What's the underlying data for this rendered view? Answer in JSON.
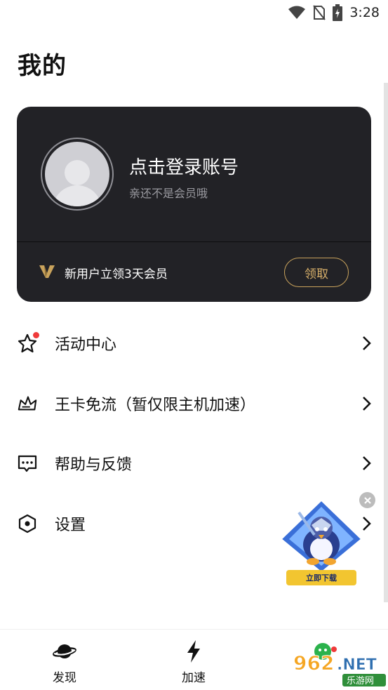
{
  "status_bar": {
    "time": "3:28",
    "icons": [
      "wifi-icon",
      "no-sim-icon",
      "battery-charging-icon"
    ]
  },
  "page_title": "我的",
  "profile_card": {
    "login_title": "点击登录账号",
    "login_subtitle": "亲还不是会员哦",
    "vip_promo": "新用户立领3天会员",
    "claim_button": "领取",
    "accent_color": "#c9a35c"
  },
  "menu": [
    {
      "label": "活动中心",
      "icon": "star-icon",
      "badge_dot": true
    },
    {
      "label": "王卡免流（暂仅限主机加速）",
      "icon": "crown-icon",
      "badge_dot": false
    },
    {
      "label": "帮助与反馈",
      "icon": "feedback-chat-icon",
      "badge_dot": false
    },
    {
      "label": "设置",
      "icon": "settings-hexagon-icon",
      "badge_dot": false
    }
  ],
  "float_ad": {
    "label": "立即下载"
  },
  "bottom_nav": [
    {
      "label": "发现",
      "icon": "planet-icon"
    },
    {
      "label": "加速",
      "icon": "lightning-icon"
    },
    {
      "label": "",
      "icon": "profile-icon"
    }
  ],
  "watermark": {
    "text": "962.NET",
    "subtext": "乐游网"
  }
}
